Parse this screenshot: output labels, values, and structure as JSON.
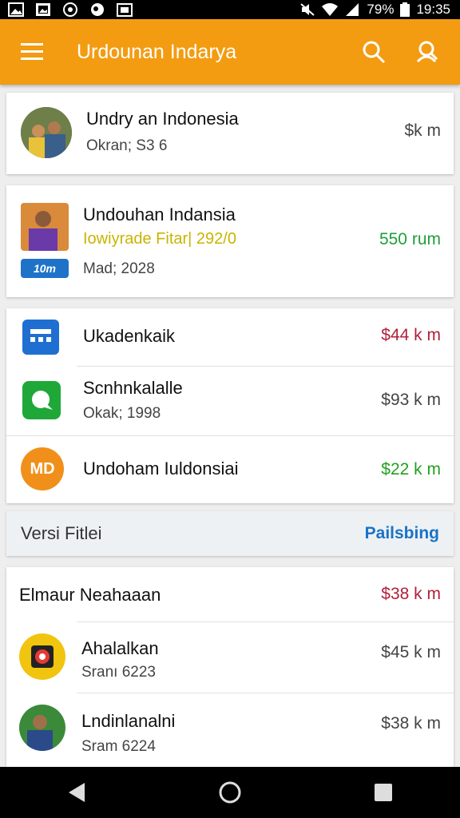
{
  "status_bar": {
    "battery": "79%",
    "time": "19:35",
    "icons": [
      "image-icon",
      "gallery-icon",
      "nfc-icon",
      "media-icon",
      "photo-icon",
      "mute-icon",
      "wifi-icon",
      "signal-icon",
      "battery-icon"
    ]
  },
  "app_bar": {
    "title": "Urdounan Indarya",
    "icons": [
      "menu-icon",
      "search-icon",
      "account-search-icon"
    ]
  },
  "cards": {
    "card1": {
      "title": "Undry an Indonesia",
      "subtitle": "Okran; S3 6",
      "price": "$k m",
      "avatar": "photo-avatar"
    },
    "card2": {
      "title": "Undouhan Indansia",
      "subtitle": "Iowiyrade Fitar| 292/0",
      "meta": "Mad; 2028",
      "badge": "10m",
      "price": "550 rum",
      "colors": {
        "subtitle": "#c9b400",
        "price": "#1e9e3a",
        "badge": "#1e73c8"
      }
    },
    "card3": {
      "items": [
        {
          "title": "Ukadenkaik",
          "price": "$44 k m",
          "price_color": "#b0213a",
          "icon": "calendar-icon",
          "icon_color": "#1e6fd1"
        },
        {
          "title": "Scnhnkalalle",
          "subtitle": "Okak; 1998",
          "price": "$93 k m",
          "price_color": "#444444",
          "icon": "chat-icon",
          "icon_color": "#1fa838"
        },
        {
          "title": "Undoham Iuldonsiai",
          "price": "$22 k m",
          "price_color": "#22a01e",
          "icon_text": "MD",
          "icon_color": "#f0901a"
        }
      ]
    },
    "section": {
      "title": "Versi Fitlei",
      "action": "Pailsbing"
    },
    "card4": {
      "items": [
        {
          "title": "Elmaur Neahaaan",
          "price": "$38 k m",
          "price_color": "#b0213a"
        },
        {
          "title": "Ahalalkan",
          "subtitle": "Sranı 6223",
          "price": "$45 k m",
          "price_color": "#444444",
          "icon": "target-icon",
          "icon_color": "#f1c40f"
        },
        {
          "title": "Lndinlanalni",
          "subtitle": "Sram 6224",
          "price": "$38 k m",
          "price_color": "#444444",
          "avatar": "photo-avatar"
        }
      ]
    }
  },
  "nav_bar": {
    "icons": [
      "back-icon",
      "home-icon",
      "recents-icon"
    ]
  }
}
